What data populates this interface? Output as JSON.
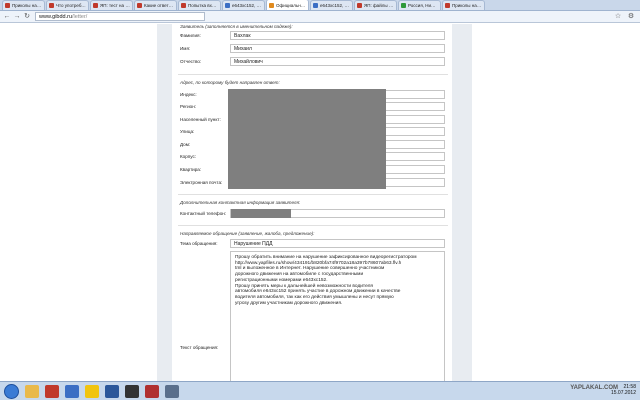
{
  "tabs": [
    {
      "label": "Приколы на ЯП",
      "icon": "red-site-icon"
    },
    {
      "label": "Что употребляю",
      "icon": "red-site-icon"
    },
    {
      "label": "ЯП: тест на Ту",
      "icon": "red-site-icon"
    },
    {
      "label": "Какие ответить",
      "icon": "red-site-icon"
    },
    {
      "label": "Попытка входа",
      "icon": "red-site-icon"
    },
    {
      "label": "e643xc152, Chr",
      "icon": "blue-site-icon"
    },
    {
      "label": "Официальный",
      "icon": "orange-site-icon",
      "active": true
    },
    {
      "label": "e643xc152, Chr",
      "icon": "blue-site-icon"
    },
    {
      "label": "ЯП: файлы - Фо",
      "icon": "red-site-icon"
    },
    {
      "label": "Россия, Нижего",
      "icon": "green-site-icon"
    },
    {
      "label": "Приколы на ЯП",
      "icon": "red-site-icon"
    }
  ],
  "address": {
    "domain": "www.gibdd.ru",
    "path": "/letter/"
  },
  "sections": {
    "applicant_title": "Заявитель (заполняется в именительном падеже):",
    "address_title": "Адрес, по которому будет направлен ответ:",
    "contact_title": "Дополнительная контактная информация заявителя:",
    "request_title": "Направляемое обращение (заявление, жалоба, предложение):"
  },
  "applicant": {
    "surname_label": "Фамилия:",
    "surname_value": "Вахлак",
    "name_label": "Имя:",
    "name_value": "Михаил",
    "patronymic_label": "Отчество:",
    "patronymic_value": "Михайлович"
  },
  "address_fields": {
    "index_label": "Индекс:",
    "region_label": "Регион:",
    "city_label": "Населенный пункт:",
    "street_label": "Улица:",
    "house_label": "Дом:",
    "building_label": "Корпус:",
    "apartment_label": "Квартира:",
    "email_label": "Электронная почта:"
  },
  "contact": {
    "phone_label": "Контактный телефон:"
  },
  "request": {
    "subject_label": "Тема обращения:",
    "subject_value": "Нарушение ПДД",
    "text_label": "Текст обращения:",
    "text_value": "Прошу обратить внимание на нарушение зафиксированное видеорегистратором\nhttp://www.yapfiles.ru/show/434191/b820bfa74f9702a18a397b78607ab63.flv.h\ntml и выложенное в Интернет. Нарушение совершенно участником\nдорожного движения на автомобиле с государственными\nрегистрационными номерами е643хс152.\nПрошу принять меры к дальнейшей невозможности водителя\nавтомобиля е643хс152 принять участие в дорожном движении в качестве\nводителя автомобиля, так как его действия умышлены и несут прямую\nугрозу другим участникам дорожного движения."
  },
  "taskbar": {
    "clock": "21:58",
    "date": "15.07.2012",
    "watermark": "YAPLAKAL.COM"
  }
}
